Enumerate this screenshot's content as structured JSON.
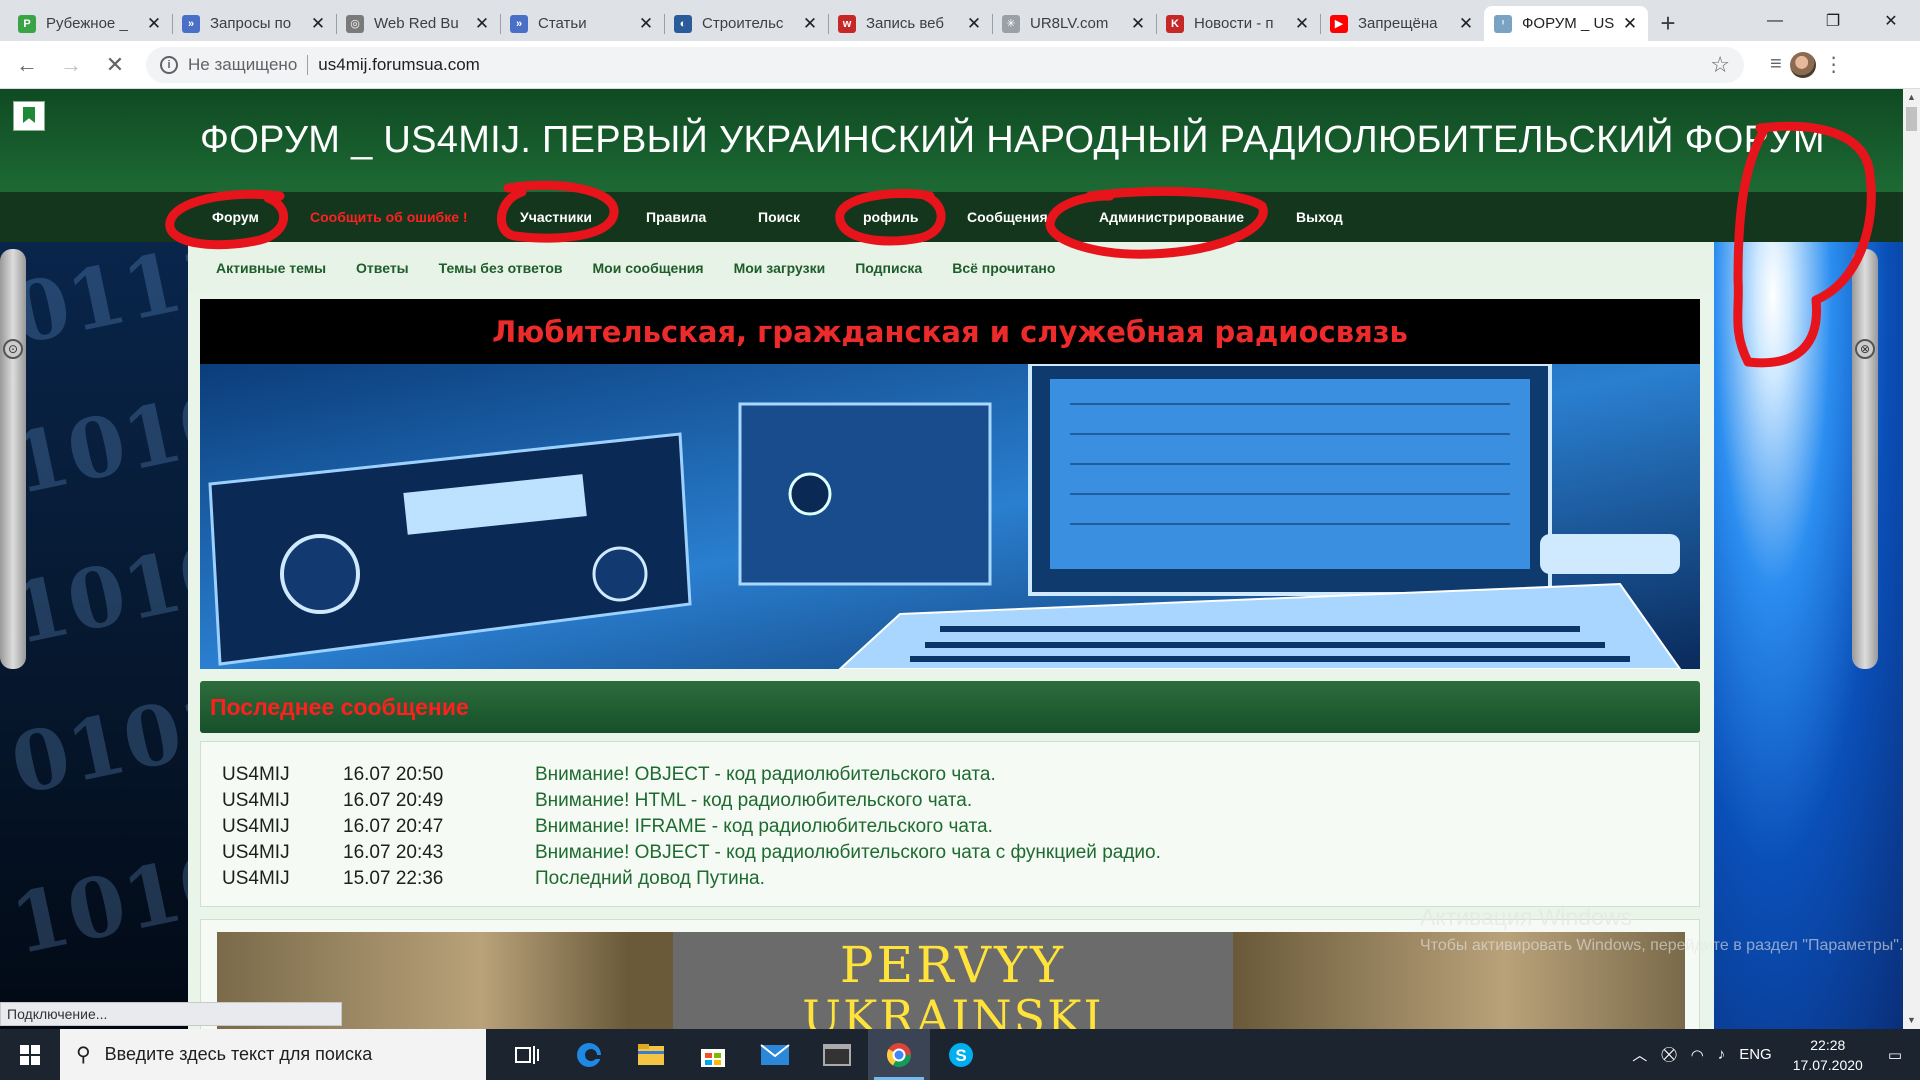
{
  "browser": {
    "tabs": [
      {
        "title": "Рубежное _",
        "favicon_color": "#3aa346",
        "favicon_char": "Р"
      },
      {
        "title": "Запросы по",
        "favicon_color": "#4a6fc7",
        "favicon_char": "»"
      },
      {
        "title": "Web Red Bu",
        "favicon_color": "#7a7a7a",
        "favicon_char": "◎"
      },
      {
        "title": "Статьи",
        "favicon_color": "#4a6fc7",
        "favicon_char": "»"
      },
      {
        "title": "Строительс",
        "favicon_color": "#2a5c9a",
        "favicon_char": "◐"
      },
      {
        "title": "Запись веб",
        "favicon_color": "#c62828",
        "favicon_char": "w"
      },
      {
        "title": "UR8LV.com",
        "favicon_color": "#9aa0a6",
        "favicon_char": "✳"
      },
      {
        "title": "Новости - п",
        "favicon_color": "#c62828",
        "favicon_char": "K"
      },
      {
        "title": "Запрещёна",
        "favicon_color": "#ff0000",
        "favicon_char": "▶"
      },
      {
        "title": "ФОРУМ _ US",
        "favicon_color": "#7aa2c2",
        "favicon_char": "ᶦ"
      }
    ],
    "active_tab_index": 9,
    "new_tab_symbol": "+",
    "security_label": "Не защищено",
    "url": "us4mij.forumsua.com",
    "status_text": "Подключение..."
  },
  "forum": {
    "site_title": "ФОРУМ _ US4MIJ. ПЕРВЫЙ УКРАИНСКИЙ НАРОДНЫЙ РАДИОЛЮБИТЕЛЬСКИЙ ФОРУМ",
    "main_nav": {
      "forum": "Форум",
      "report_error": "Сообщить об ошибке !",
      "members": "Участники",
      "rules": "Правила",
      "search": "Поиск",
      "profile": "рофиль",
      "messages": "Сообщения",
      "admin": "Администрирование",
      "logout": "Выход"
    },
    "sub_nav": [
      "Активные темы",
      "Ответы",
      "Темы без ответов",
      "Мои сообщения",
      "Мои загрузки",
      "Подписка",
      "Всё прочитано"
    ],
    "banner_title": "Любительская, гражданская и служебная радиосвязь",
    "last_post_header": "Последнее сообщение",
    "last_posts": [
      {
        "author": "US4MIJ",
        "time": "16.07 20:50",
        "subject": "Внимание! OBJECT - код радиолюбительского чата."
      },
      {
        "author": "US4MIJ",
        "time": "16.07 20:49",
        "subject": "Внимание! HTML - код радиолюбительского чата."
      },
      {
        "author": "US4MIJ",
        "time": "16.07 20:47",
        "subject": "Внимание! IFRAME - код радиолюбительского чата."
      },
      {
        "author": "US4MIJ",
        "time": "16.07 20:43",
        "subject": "Внимание! OBJECT - код радиолюбительского чата с функцией радио."
      },
      {
        "author": "US4MIJ",
        "time": "15.07 22:36",
        "subject": "Последний довод Путина."
      }
    ],
    "second_banner": {
      "line1": "PERVYY",
      "line2": "UKRAINSKI NARODNYY"
    }
  },
  "windows_watermark": {
    "title": "Активация Windows",
    "text": "Чтобы активировать Windows, перейдите в раздел \"Параметры\"."
  },
  "taskbar": {
    "search_placeholder": "Введите здесь текст для поиска",
    "language": "ENG",
    "time": "22:28",
    "date": "17.07.2020"
  },
  "colors": {
    "header_green": "#0f4a22",
    "nav_dark_green": "#14361d",
    "link_red": "#ff2020",
    "annotation_red": "#e8141c"
  }
}
